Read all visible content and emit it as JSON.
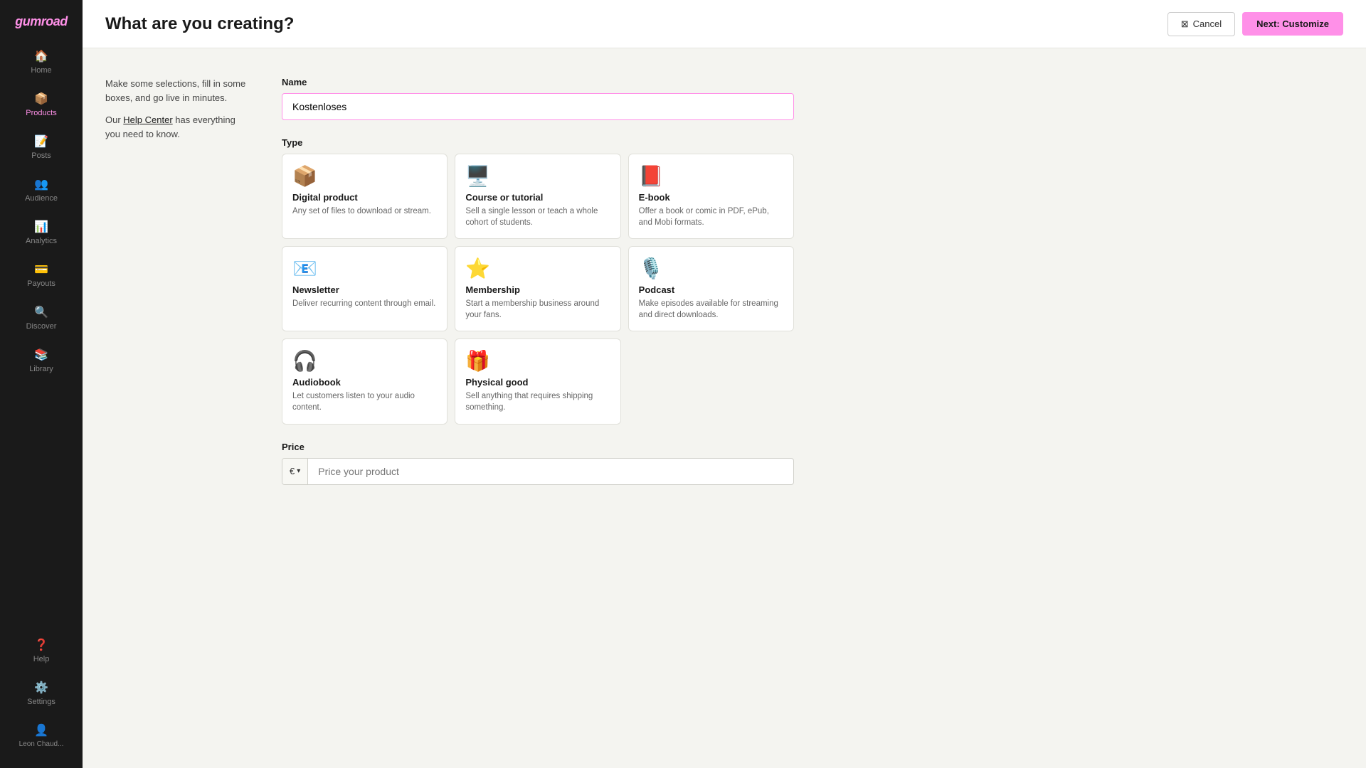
{
  "page": {
    "title": "What are you creating?"
  },
  "sidebar": {
    "logo": "gumroad",
    "items": [
      {
        "id": "home",
        "label": "Home",
        "icon": "🏠",
        "active": false
      },
      {
        "id": "products",
        "label": "Products",
        "icon": "📦",
        "active": true
      },
      {
        "id": "posts",
        "label": "Posts",
        "icon": "📝",
        "active": false
      },
      {
        "id": "audience",
        "label": "Audience",
        "icon": "👥",
        "active": false
      },
      {
        "id": "analytics",
        "label": "Analytics",
        "icon": "📊",
        "active": false
      },
      {
        "id": "payouts",
        "label": "Payouts",
        "icon": "💳",
        "active": false
      },
      {
        "id": "discover",
        "label": "Discover",
        "icon": "🔍",
        "active": false
      },
      {
        "id": "library",
        "label": "Library",
        "icon": "📚",
        "active": false
      }
    ],
    "bottom": [
      {
        "id": "help",
        "label": "Help",
        "icon": "❓"
      },
      {
        "id": "settings",
        "label": "Settings",
        "icon": "⚙️"
      }
    ],
    "user": {
      "name": "Leon Chaud...",
      "icon": "👤"
    }
  },
  "header": {
    "cancel_label": "Cancel",
    "next_label": "Next: Customize"
  },
  "form": {
    "info_text": "Make some selections, fill in some boxes, and go live in minutes.",
    "help_text": "Our",
    "help_link_text": "Help Center",
    "help_after": "has everything you need to know.",
    "name_label": "Name",
    "name_value": "Kostenloses",
    "name_placeholder": "",
    "type_label": "Type",
    "price_label": "Price",
    "price_placeholder": "Price your product",
    "currency": "€",
    "types": [
      {
        "id": "digital",
        "name": "Digital product",
        "desc": "Any set of files to download or stream.",
        "icon": "📦",
        "color": "#e8a87c"
      },
      {
        "id": "course",
        "name": "Course or tutorial",
        "desc": "Sell a single lesson or teach a whole cohort of students.",
        "icon": "🖥️",
        "color": "#5bb4b4"
      },
      {
        "id": "ebook",
        "name": "E-book",
        "desc": "Offer a book or comic in PDF, ePub, and Mobi formats.",
        "icon": "📕",
        "color": "#e8c84a"
      },
      {
        "id": "newsletter",
        "name": "Newsletter",
        "desc": "Deliver recurring content through email.",
        "icon": "📧",
        "color": "#6b8de0"
      },
      {
        "id": "membership",
        "name": "Membership",
        "desc": "Start a membership business around your fans.",
        "icon": "⭐",
        "color": "#f0c040"
      },
      {
        "id": "podcast",
        "name": "Podcast",
        "desc": "Make episodes available for streaming and direct downloads.",
        "icon": "🎙️",
        "color": "#e05050"
      },
      {
        "id": "audiobook",
        "name": "Audiobook",
        "desc": "Let customers listen to your audio content.",
        "icon": "🎧",
        "color": "#c060c0"
      },
      {
        "id": "physical",
        "name": "Physical good",
        "desc": "Sell anything that requires shipping something.",
        "icon": "🎁",
        "color": "#e0a020"
      }
    ]
  }
}
